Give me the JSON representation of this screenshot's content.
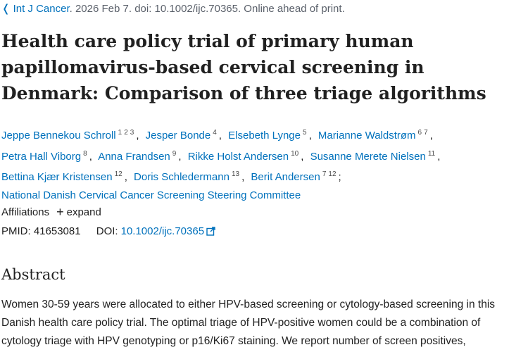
{
  "citation": {
    "journal": "Int J Cancer",
    "details": ". 2026 Feb 7. doi: 10.1002/ijc.70365. Online ahead of print."
  },
  "title": {
    "lines": [
      "Health care policy trial of primary human",
      "papillomavirus-based cervical screening in",
      "Denmark: Comparison of three triage algorithms"
    ]
  },
  "authors": [
    {
      "name": "Jeppe Bennekou Schroll",
      "affs": [
        "1",
        "2",
        "3"
      ]
    },
    {
      "name": "Jesper Bonde",
      "affs": [
        "4"
      ]
    },
    {
      "name": "Elsebeth Lynge",
      "affs": [
        "5"
      ]
    },
    {
      "name": "Marianne Waldstrøm",
      "affs": [
        "6",
        "7"
      ]
    },
    {
      "name": "Petra Hall Viborg",
      "affs": [
        "8"
      ]
    },
    {
      "name": "Anna Frandsen",
      "affs": [
        "9"
      ]
    },
    {
      "name": "Rikke Holst Andersen",
      "affs": [
        "10"
      ]
    },
    {
      "name": "Susanne Merete Nielsen",
      "affs": [
        "11"
      ]
    },
    {
      "name": "Bettina Kjær Kristensen",
      "affs": [
        "12"
      ]
    },
    {
      "name": "Doris Schledermann",
      "affs": [
        "13"
      ]
    },
    {
      "name": "Berit Andersen",
      "affs": [
        "7",
        "12"
      ]
    }
  ],
  "group_author": "National Danish Cervical Cancer Screening Steering Committee",
  "affiliations": {
    "label": "Affiliations",
    "expand_label": "expand"
  },
  "identifiers": {
    "pmid_label": "PMID:",
    "pmid": "41653081",
    "doi_label": "DOI:",
    "doi": "10.1002/ijc.70365"
  },
  "abstract": {
    "heading": "Abstract",
    "lines": [
      "Women 30-59 years were allocated to either HPV-based screening or cytology-based screening in this",
      "Danish health care policy trial. The optimal triage of HPV-positive women could be a combination of",
      "cytology triage with HPV genotyping or p16/Ki67 staining. We report number of screen positives,"
    ]
  },
  "colors": {
    "link": "#0071bc",
    "text": "#212121",
    "muted": "#5b616b"
  },
  "icons": [
    "chevron-left-icon",
    "plus-icon",
    "external-link-icon"
  ]
}
